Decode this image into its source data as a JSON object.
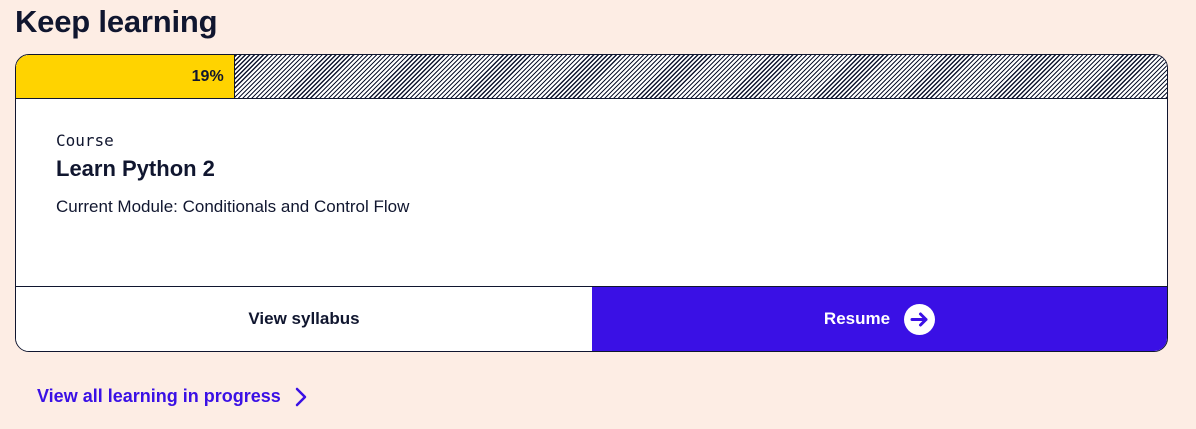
{
  "heading": "Keep learning",
  "card": {
    "progress": {
      "label": "19%",
      "fraction": 0.19
    },
    "course_type": "Course",
    "course_title": "Learn Python 2",
    "current_module": "Current Module: Conditionals and Control Flow",
    "view_syllabus_label": "View syllabus",
    "resume_label": "Resume",
    "resume_icon": "arrow-right-circle-icon"
  },
  "view_all": {
    "label": "View all learning in progress",
    "icon": "chevron-right-icon"
  },
  "colors": {
    "page_background": "#fdede4",
    "progress_fill": "#ffd300",
    "accent": "#3a10e5",
    "text": "#10162f"
  }
}
